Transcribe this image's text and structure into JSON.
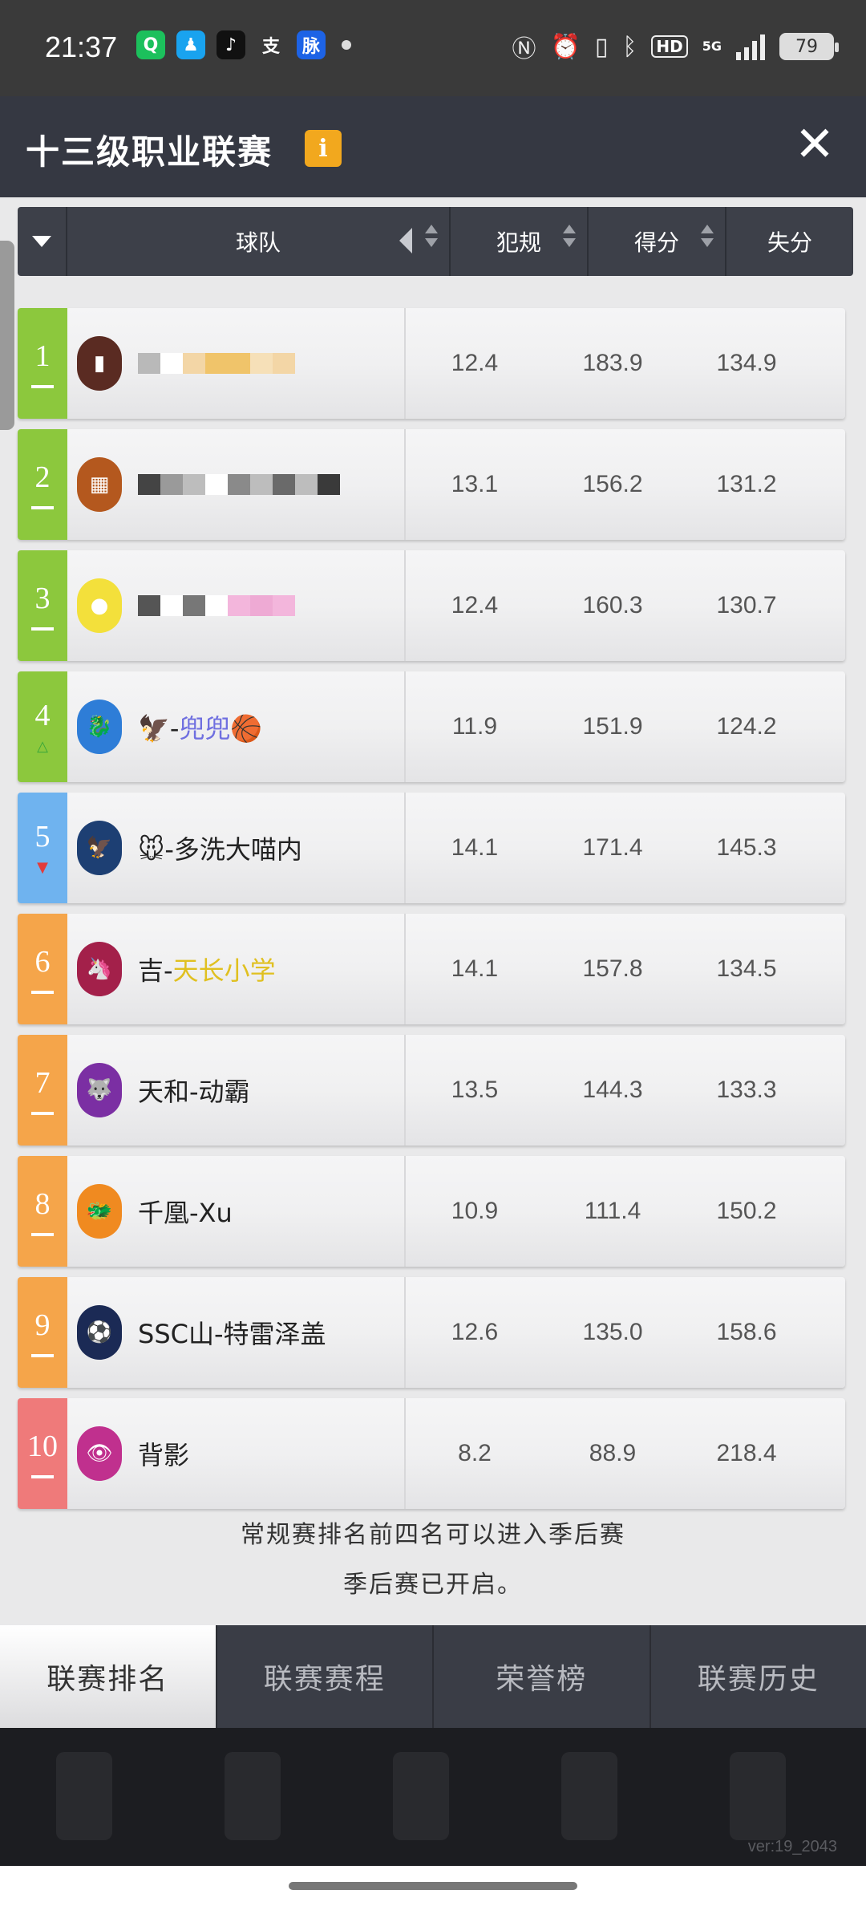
{
  "status_bar": {
    "time": "21:37",
    "apps": [
      {
        "icon": "chat-app-icon",
        "glyph": "Q",
        "color": "#1cc05c"
      },
      {
        "icon": "qq-icon",
        "glyph": "♟",
        "color": "#19a3ef"
      },
      {
        "icon": "tiktok-icon",
        "glyph": "♪",
        "color": "#111111"
      },
      {
        "icon": "alipay-icon",
        "glyph": "支",
        "color": "#3a3a3a"
      },
      {
        "icon": "maimai-icon",
        "glyph": "脉",
        "color": "#1d63e6"
      }
    ],
    "hd_label": "HD",
    "network": "5G",
    "battery": "79"
  },
  "header": {
    "title": "十三级职业联赛",
    "info_label": "i",
    "close_label": "✕"
  },
  "table": {
    "columns": {
      "team": "球队",
      "fouls": "犯规",
      "points_for": "得分",
      "points_against": "失分"
    },
    "rows": [
      {
        "rank": "1",
        "trend": "same",
        "color": "#8cc83d",
        "name": "",
        "logo_color": "#5a2b22",
        "logo_glyph": "▮",
        "fouls": "12.4",
        "points_for": "183.9",
        "points_against": "134.9",
        "blurred": [
          "#b9b9b9",
          "#ffffff",
          "#f3d6a6",
          "#f0c46a",
          "#f0c46a",
          "#f6e0b8",
          "#f3d6a6"
        ]
      },
      {
        "rank": "2",
        "trend": "same",
        "color": "#8cc83d",
        "name": "",
        "logo_color": "#b4581e",
        "logo_glyph": "▦",
        "fouls": "13.1",
        "points_for": "156.2",
        "points_against": "131.2",
        "blurred": [
          "#444444",
          "#9a9a9a",
          "#bdbdbd",
          "#ffffff",
          "#8a8a8a",
          "#bdbdbd",
          "#6a6a6a",
          "#bdbdbd",
          "#3a3a3a"
        ]
      },
      {
        "rank": "3",
        "trend": "same",
        "color": "#8cc83d",
        "name": "",
        "logo_color": "#f3e03b",
        "logo_glyph": "●",
        "fouls": "12.4",
        "points_for": "160.3",
        "points_against": "130.7",
        "blurred": [
          "#555555",
          "#ffffff",
          "#777777",
          "#ffffff",
          "#f3b6dc",
          "#eeaad4",
          "#f3b6dc"
        ]
      },
      {
        "rank": "4",
        "trend": "up",
        "color": "#8cc83d",
        "name_prefix": "🦅-",
        "name": "兜兜",
        "name_suffix": "🏀",
        "name_color": "#6f6fe0",
        "logo_color": "#2e7dd7",
        "logo_glyph": "🐉",
        "fouls": "11.9",
        "points_for": "151.9",
        "points_against": "124.2"
      },
      {
        "rank": "5",
        "trend": "down",
        "color": "#6fb3ef",
        "name_prefix": "🐭-",
        "name": "多洗大喵内",
        "name_suffix": "",
        "name_color": "#222222",
        "logo_color": "#1d3f73",
        "logo_glyph": "🦅",
        "fouls": "14.1",
        "points_for": "171.4",
        "points_against": "145.3"
      },
      {
        "rank": "6",
        "trend": "same",
        "color": "#f5a54a",
        "name_prefix": "吉-",
        "name": "天长小学",
        "name_suffix": "",
        "name_color": "#e0c020",
        "logo_color": "#a3204a",
        "logo_glyph": "🦄",
        "fouls": "14.1",
        "points_for": "157.8",
        "points_against": "134.5"
      },
      {
        "rank": "7",
        "trend": "same",
        "color": "#f5a54a",
        "name_prefix": "",
        "name": "天和-动霸",
        "name_suffix": "",
        "name_color": "#222222",
        "logo_color": "#7b2fa3",
        "logo_glyph": "🐺",
        "fouls": "13.5",
        "points_for": "144.3",
        "points_against": "133.3"
      },
      {
        "rank": "8",
        "trend": "same",
        "color": "#f5a54a",
        "name_prefix": "",
        "name": "千凰-Xu",
        "name_suffix": "",
        "name_color": "#222222",
        "logo_color": "#f08a20",
        "logo_glyph": "🐲",
        "fouls": "10.9",
        "points_for": "111.4",
        "points_against": "150.2"
      },
      {
        "rank": "9",
        "trend": "same",
        "color": "#f5a54a",
        "name_prefix": "",
        "name": "SSC山-特雷泽盖",
        "name_suffix": "",
        "name_color": "#222222",
        "logo_color": "#1b2a55",
        "logo_glyph": "⚽",
        "fouls": "12.6",
        "points_for": "135.0",
        "points_against": "158.6"
      },
      {
        "rank": "10",
        "trend": "same",
        "color": "#ef7a7a",
        "name_prefix": "",
        "name": "背影",
        "name_suffix": "",
        "name_color": "#222222",
        "logo_color": "#c0308e",
        "logo_glyph": "👁",
        "fouls": "8.2",
        "points_for": "88.9",
        "points_against": "218.4"
      }
    ]
  },
  "notes": {
    "line1": "常规赛排名前四名可以进入季后赛",
    "line2": "季后赛已开启。"
  },
  "tabs": [
    {
      "label": "联赛排名",
      "active": true
    },
    {
      "label": "联赛赛程",
      "active": false
    },
    {
      "label": "荣誉榜",
      "active": false
    },
    {
      "label": "联赛历史",
      "active": false
    }
  ],
  "version": "ver:19_2043"
}
